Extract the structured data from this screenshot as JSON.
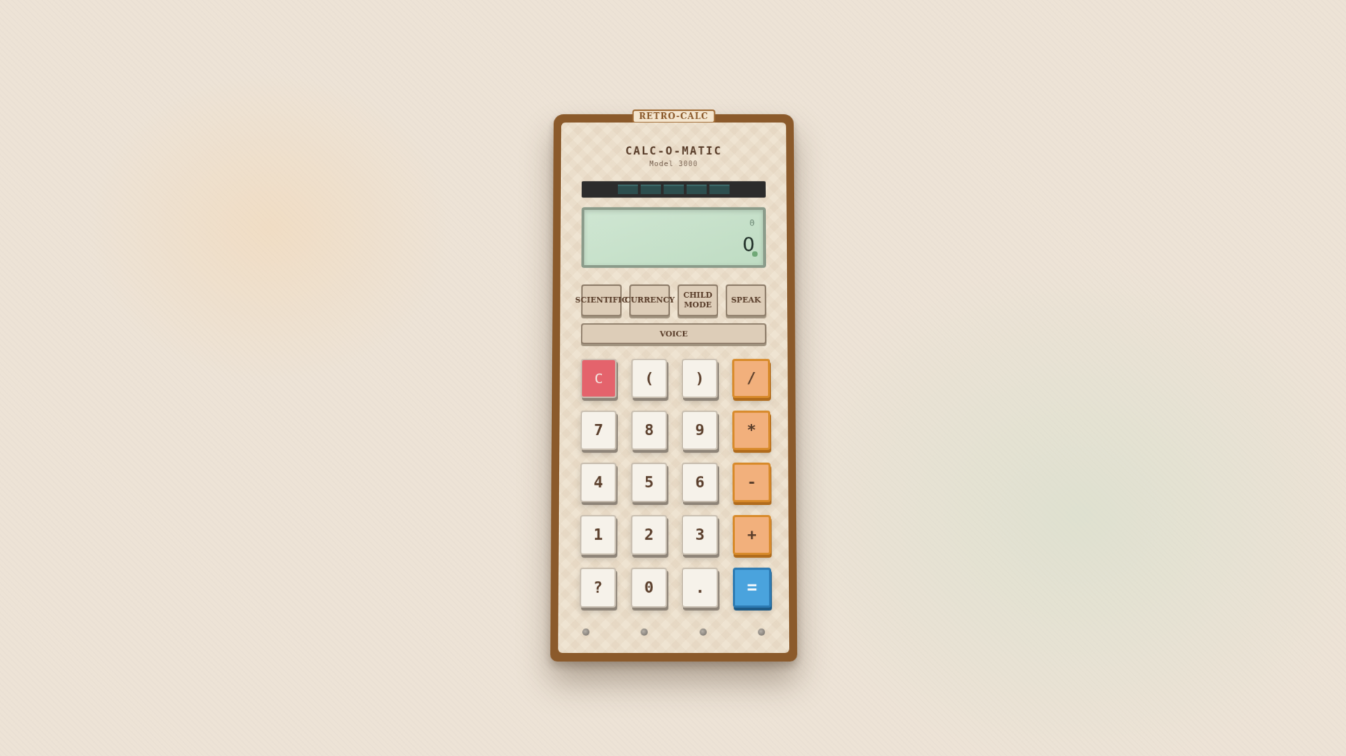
{
  "calculator": {
    "badge": "RETRO-CALC",
    "brand": "CALC-O-MATIC",
    "model": "Model 3000",
    "solar_cells": 5,
    "display": {
      "expression": "0",
      "value": "0"
    },
    "function_buttons": [
      {
        "label": "SCIENTIFIC"
      },
      {
        "label": "CURRENCY"
      },
      {
        "label": "CHILD MODE"
      },
      {
        "label": "SPEAK"
      }
    ],
    "voice_button": "VOICE",
    "keys": [
      {
        "label": "C",
        "type": "clear"
      },
      {
        "label": "(",
        "type": "num"
      },
      {
        "label": ")",
        "type": "num"
      },
      {
        "label": "/",
        "type": "op"
      },
      {
        "label": "7",
        "type": "num"
      },
      {
        "label": "8",
        "type": "num"
      },
      {
        "label": "9",
        "type": "num"
      },
      {
        "label": "*",
        "type": "op"
      },
      {
        "label": "4",
        "type": "num"
      },
      {
        "label": "5",
        "type": "num"
      },
      {
        "label": "6",
        "type": "num"
      },
      {
        "label": "-",
        "type": "op"
      },
      {
        "label": "1",
        "type": "num"
      },
      {
        "label": "2",
        "type": "num"
      },
      {
        "label": "3",
        "type": "num"
      },
      {
        "label": "+",
        "type": "op"
      },
      {
        "label": "?",
        "type": "num"
      },
      {
        "label": "0",
        "type": "num"
      },
      {
        "label": ".",
        "type": "num"
      },
      {
        "label": "=",
        "type": "eq"
      }
    ],
    "colors": {
      "case": "#8b5a2b",
      "clear_key": "#e4636c",
      "operator_key": "#f2b07c",
      "equals_key": "#4aa3dd",
      "lcd": "#c8e2cb"
    }
  }
}
